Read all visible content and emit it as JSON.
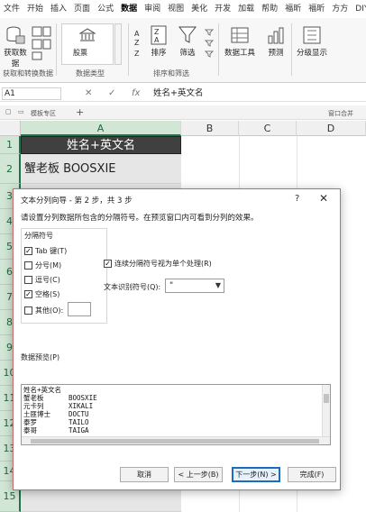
{
  "ribbon": {
    "tabs": [
      "文件",
      "开始",
      "插入",
      "页面",
      "公式",
      "数据",
      "审阅",
      "视图",
      "美化",
      "开发",
      "加载",
      "帮助",
      "福昕",
      "福昕",
      "方方",
      "DIY"
    ],
    "active_tab": "数据",
    "buttons": {
      "get_data": "获取数据",
      "stocks": "股票",
      "sort": "排序",
      "filter": "筛选",
      "data_tools": "数据工具",
      "forecast": "预测",
      "outline": "分级显示"
    },
    "groups": {
      "get_transform": "获取和转换数据",
      "data_types": "数据类型",
      "sort_filter": "排序和筛选"
    }
  },
  "formula_bar": {
    "name_box": "A1",
    "fx": "fx",
    "content": "姓名+英文名"
  },
  "sheet_bar": {
    "label": "模板专区",
    "right_label": "窗口合并"
  },
  "grid": {
    "columns": [
      "A",
      "B",
      "C",
      "D"
    ],
    "rows": [
      "1",
      "2",
      "3",
      "4",
      "5",
      "6",
      "7",
      "8",
      "9",
      "10",
      "11",
      "12",
      "13",
      "14",
      "15"
    ],
    "a1": "姓名+英文名",
    "a2": "蟹老板 BOOSXIE"
  },
  "dialog": {
    "title": "文本分列向导 - 第 2 步，共 3 步",
    "help": "?",
    "close": "✕",
    "description": "请设置分列数据所包含的分隔符号。在预览窗口内可看到分列的效果。",
    "delimiters_title": "分隔符号",
    "delimiters": [
      {
        "label": "Tab 键(T)",
        "checked": true
      },
      {
        "label": "分号(M)",
        "checked": false
      },
      {
        "label": "逗号(C)",
        "checked": false
      },
      {
        "label": "空格(S)",
        "checked": true
      },
      {
        "label": "其他(O):",
        "checked": false
      }
    ],
    "consecutive_label": "连续分隔符号视为单个处理(R)",
    "consecutive_checked": true,
    "qualifier_label": "文本识别符号(Q):",
    "qualifier_value": "\"",
    "preview_label": "数据预览(P)",
    "preview_rows": [
      [
        "姓名+英文名",
        ""
      ],
      [
        "蟹老板",
        "BOOSXIE"
      ],
      [
        "元卡列",
        "XIKALI"
      ],
      [
        "土匪博士",
        "DOCTU"
      ],
      [
        "泰罗",
        "TAILO"
      ],
      [
        "泰哥",
        "TAIGA"
      ]
    ],
    "buttons": {
      "cancel": "取消",
      "back": "< 上一步(B)",
      "next": "下一步(N) >",
      "finish": "完成(F)"
    }
  }
}
